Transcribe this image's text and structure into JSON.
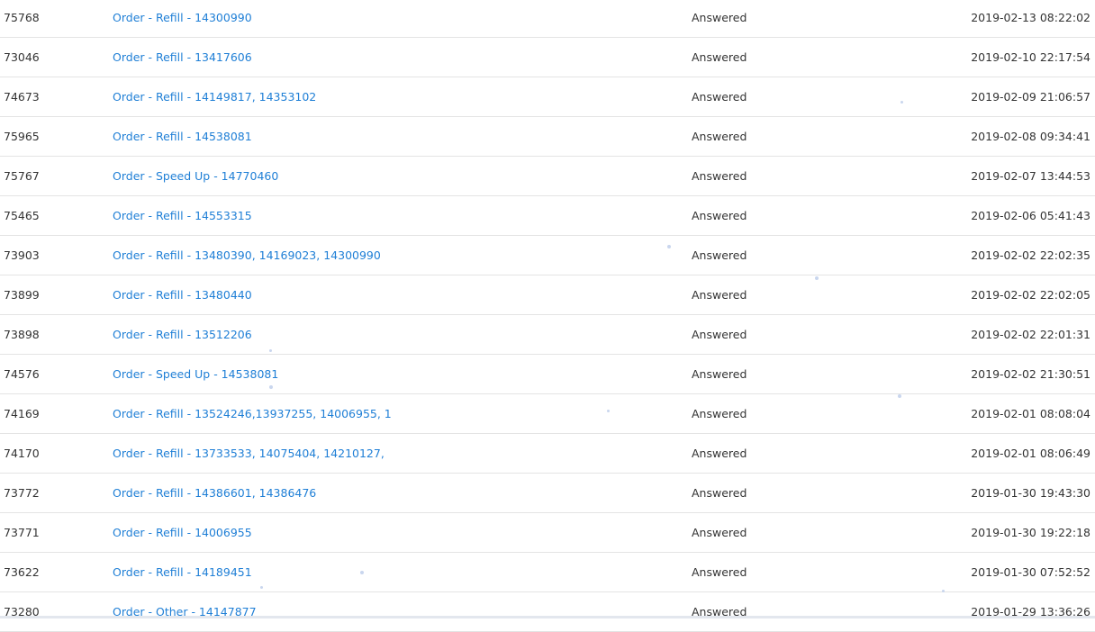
{
  "tickets": [
    {
      "id": "75768",
      "subject": "Order - Refill - 14300990",
      "status": "Answered",
      "date": "2019-02-13 08:22:02"
    },
    {
      "id": "73046",
      "subject": "Order - Refill - 13417606",
      "status": "Answered",
      "date": "2019-02-10 22:17:54"
    },
    {
      "id": "74673",
      "subject": "Order - Refill - 14149817, 14353102",
      "status": "Answered",
      "date": "2019-02-09 21:06:57"
    },
    {
      "id": "75965",
      "subject": "Order - Refill - 14538081",
      "status": "Answered",
      "date": "2019-02-08 09:34:41"
    },
    {
      "id": "75767",
      "subject": "Order - Speed Up - 14770460",
      "status": "Answered",
      "date": "2019-02-07 13:44:53"
    },
    {
      "id": "75465",
      "subject": "Order - Refill - 14553315",
      "status": "Answered",
      "date": "2019-02-06 05:41:43"
    },
    {
      "id": "73903",
      "subject": "Order - Refill - 13480390, 14169023, 14300990",
      "status": "Answered",
      "date": "2019-02-02 22:02:35"
    },
    {
      "id": "73899",
      "subject": "Order - Refill - 13480440",
      "status": "Answered",
      "date": "2019-02-02 22:02:05"
    },
    {
      "id": "73898",
      "subject": "Order - Refill - 13512206",
      "status": "Answered",
      "date": "2019-02-02 22:01:31"
    },
    {
      "id": "74576",
      "subject": "Order - Speed Up - 14538081",
      "status": "Answered",
      "date": "2019-02-02 21:30:51"
    },
    {
      "id": "74169",
      "subject": "Order - Refill - 13524246,13937255, 14006955, 1",
      "status": "Answered",
      "date": "2019-02-01 08:08:04"
    },
    {
      "id": "74170",
      "subject": "Order - Refill - 13733533, 14075404, 14210127,",
      "status": "Answered",
      "date": "2019-02-01 08:06:49"
    },
    {
      "id": "73772",
      "subject": "Order - Refill - 14386601, 14386476",
      "status": "Answered",
      "date": "2019-01-30 19:43:30"
    },
    {
      "id": "73771",
      "subject": "Order - Refill - 14006955",
      "status": "Answered",
      "date": "2019-01-30 19:22:18"
    },
    {
      "id": "73622",
      "subject": "Order - Refill - 14189451",
      "status": "Answered",
      "date": "2019-01-30 07:52:52"
    },
    {
      "id": "73280",
      "subject": "Order - Other - 14147877",
      "status": "Answered",
      "date": "2019-01-29 13:36:26"
    }
  ]
}
